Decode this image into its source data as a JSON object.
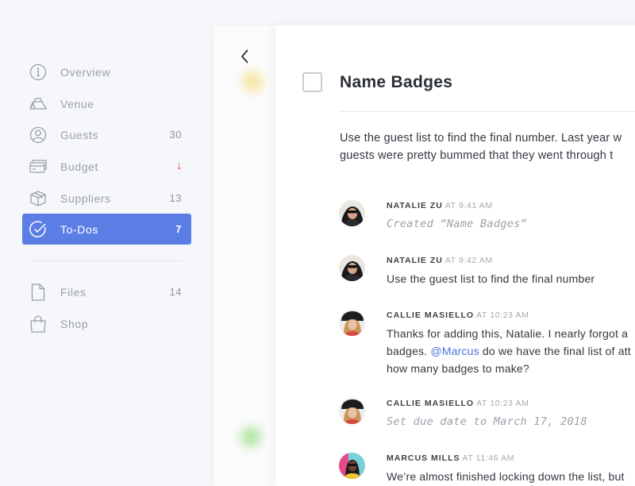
{
  "sidebar": {
    "items": [
      {
        "label": "Overview",
        "count": "",
        "icon": "info-icon"
      },
      {
        "label": "Venue",
        "count": "",
        "icon": "venue-icon"
      },
      {
        "label": "Guests",
        "count": "30",
        "icon": "guests-icon"
      },
      {
        "label": "Budget",
        "count": "↓",
        "icon": "budget-card-icon"
      },
      {
        "label": "Suppliers",
        "count": "13",
        "icon": "box-icon"
      },
      {
        "label": "To-Dos",
        "count": "7",
        "icon": "check-circle-icon",
        "active": true
      },
      {
        "label": "Files",
        "count": "14",
        "icon": "file-icon"
      },
      {
        "label": "Shop",
        "count": "",
        "icon": "shopping-bag-icon"
      }
    ]
  },
  "task": {
    "title": "Name Badges",
    "description_line1": "Use the guest list to find the final number. Last year w",
    "description_line2": "guests were pretty bummed that they went through t"
  },
  "comments": [
    {
      "author": "NATALIE ZU",
      "time": "AT 9:41 AM",
      "lines": [
        "Created “Name Badges”"
      ],
      "activity": true
    },
    {
      "author": "NATALIE ZU",
      "time": "AT 9:42 AM",
      "lines": [
        "Use the guest list to find the final number"
      ],
      "activity": false
    },
    {
      "author": "CALLIE MASIELLO",
      "time": "AT 10:23 AM",
      "line1": "Thanks for adding this, Natalie. I nearly forgot a",
      "line2_pre": "badges. ",
      "mention": "@Marcus",
      "line2_post": " do we have the final list of att",
      "line3": "how many badges to make?"
    },
    {
      "author": "CALLIE MASIELLO",
      "time": "AT 10:23 AM",
      "lines": [
        "Set due date to March 17, 2018"
      ],
      "activity": true
    },
    {
      "author": "MARCUS MILLS",
      "time": "AT 11:46 AM",
      "lines": [
        "We’re almost finished locking down the list, but"
      ],
      "activity": false
    }
  ],
  "colors": {
    "accent": "#5b7ee5",
    "mention": "#4b73d9",
    "alert": "#e0433b"
  }
}
